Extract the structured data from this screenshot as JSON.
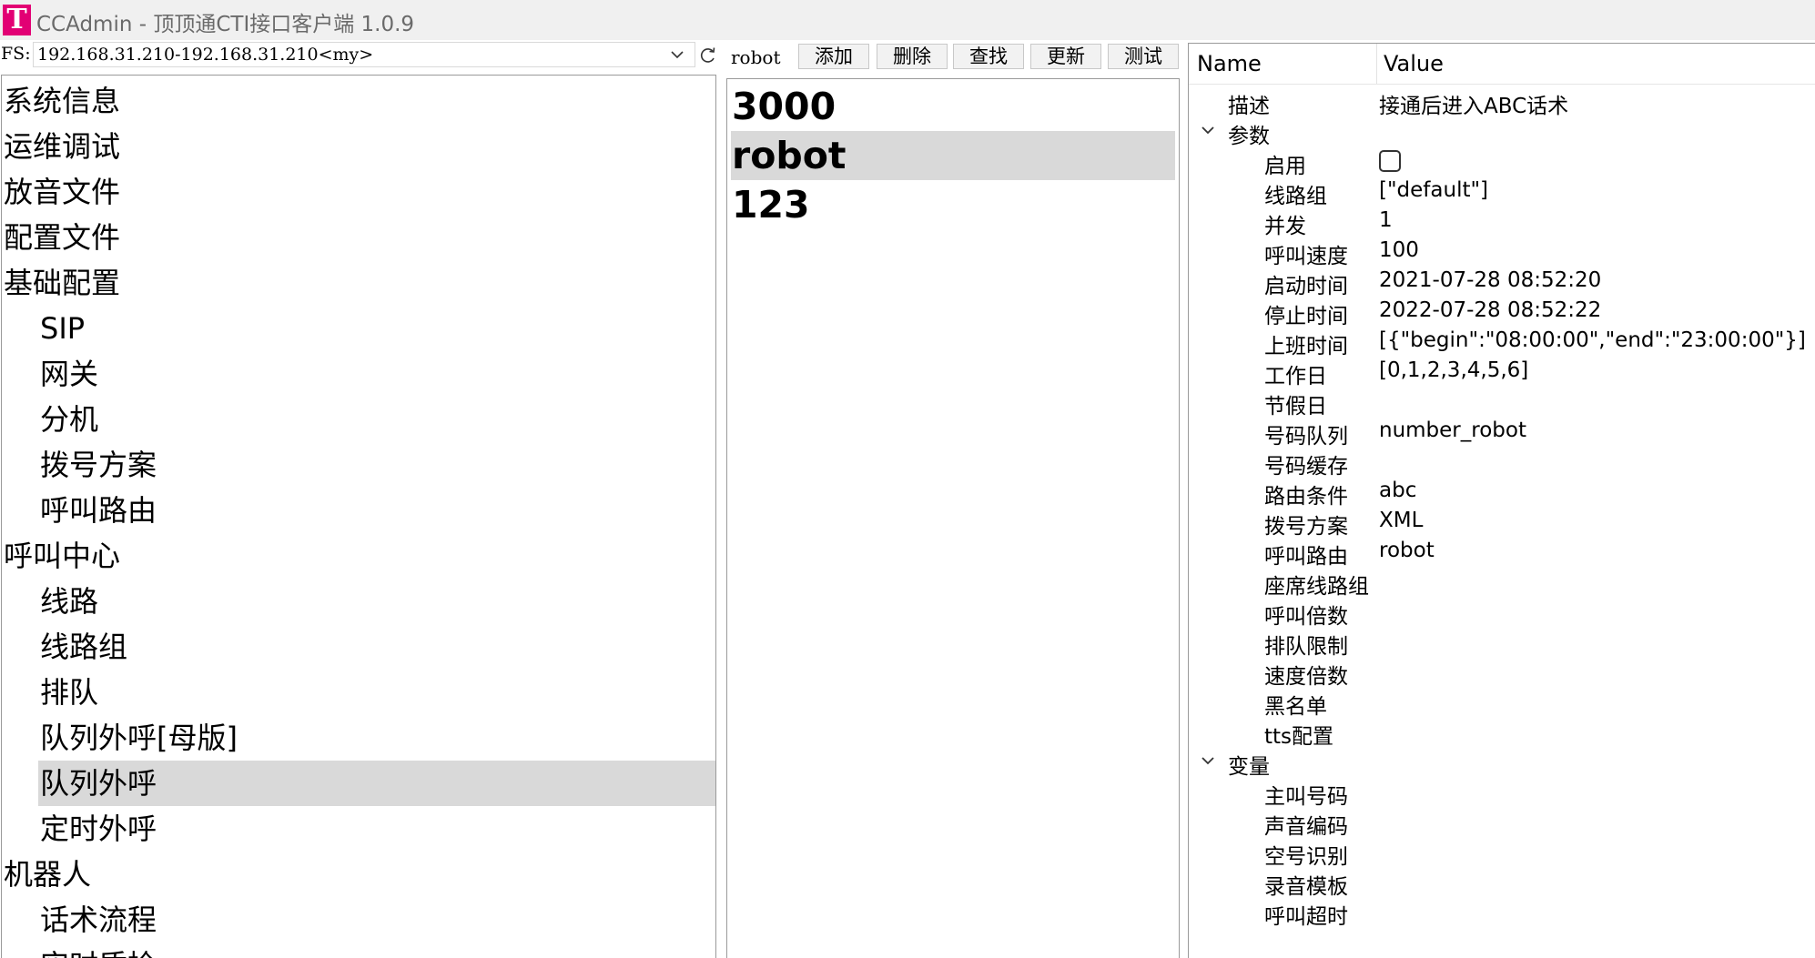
{
  "window": {
    "logo": "T",
    "title": "CCAdmin - 顶顶通CTI接口客户端 1.0.9"
  },
  "fs": {
    "label": "FS:",
    "selected": "192.168.31.210-192.168.31.210<my>"
  },
  "tree": {
    "items": [
      {
        "label": "系统信息",
        "level": 0
      },
      {
        "label": "运维调试",
        "level": 0
      },
      {
        "label": "放音文件",
        "level": 0
      },
      {
        "label": "配置文件",
        "level": 0
      },
      {
        "label": "基础配置",
        "level": 0
      },
      {
        "label": "SIP",
        "level": 1
      },
      {
        "label": "网关",
        "level": 1
      },
      {
        "label": "分机",
        "level": 1
      },
      {
        "label": "拨号方案",
        "level": 1
      },
      {
        "label": "呼叫路由",
        "level": 1
      },
      {
        "label": "呼叫中心",
        "level": 0
      },
      {
        "label": "线路",
        "level": 1
      },
      {
        "label": "线路组",
        "level": 1
      },
      {
        "label": "排队",
        "level": 1
      },
      {
        "label": "队列外呼[母版]",
        "level": 1
      },
      {
        "label": "队列外呼",
        "level": 1,
        "selected": true
      },
      {
        "label": "定时外呼",
        "level": 1
      },
      {
        "label": "机器人",
        "level": 0
      },
      {
        "label": "话术流程",
        "level": 1
      },
      {
        "label": "实时质检",
        "level": 1
      }
    ]
  },
  "toolbar": {
    "tab_label": "robot",
    "add": "添加",
    "delete": "删除",
    "find": "查找",
    "update": "更新",
    "test": "测试"
  },
  "list": {
    "items": [
      {
        "label": "3000"
      },
      {
        "label": "robot",
        "selected": true
      },
      {
        "label": "123"
      }
    ]
  },
  "props": {
    "header_name": "Name",
    "header_value": "Value",
    "description": {
      "key": "描述",
      "value": "接通后进入ABC话术"
    },
    "params_group": "参数",
    "params": {
      "enabled": {
        "key": "启用",
        "checked": false
      },
      "line_group": {
        "key": "线路组",
        "value": "[\"default\"]"
      },
      "concurrency": {
        "key": "并发",
        "value": "1"
      },
      "call_speed": {
        "key": "呼叫速度",
        "value": "100"
      },
      "start_time": {
        "key": "启动时间",
        "value": "2021-07-28 08:52:20"
      },
      "stop_time": {
        "key": "停止时间",
        "value": "2022-07-28 08:52:22"
      },
      "work_hours": {
        "key": "上班时间",
        "value": "[{\"begin\":\"08:00:00\",\"end\":\"23:00:00\"}]"
      },
      "workdays": {
        "key": "工作日",
        "value": "[0,1,2,3,4,5,6]"
      },
      "holidays": {
        "key": "节假日",
        "value": ""
      },
      "number_queue": {
        "key": "号码队列",
        "value": "number_robot"
      },
      "number_cache": {
        "key": "号码缓存",
        "value": ""
      },
      "route_condition": {
        "key": "路由条件",
        "value": "abc"
      },
      "dial_plan": {
        "key": "拨号方案",
        "value": "XML"
      },
      "call_route": {
        "key": "呼叫路由",
        "value": "robot"
      },
      "agent_line_group": {
        "key": "座席线路组",
        "value": ""
      },
      "call_multiplier": {
        "key": "呼叫倍数",
        "value": ""
      },
      "queue_limit": {
        "key": "排队限制",
        "value": ""
      },
      "speed_multiplier": {
        "key": "速度倍数",
        "value": ""
      },
      "blacklist": {
        "key": "黑名单",
        "value": ""
      },
      "tts_config": {
        "key": "tts配置",
        "value": ""
      }
    },
    "vars_group": "变量",
    "vars": {
      "caller_number": {
        "key": "主叫号码"
      },
      "voice_codec": {
        "key": "声音编码"
      },
      "empty_number_detect": {
        "key": "空号识别"
      },
      "record_template": {
        "key": "录音模板"
      },
      "call_timeout": {
        "key": "呼叫超时"
      }
    }
  }
}
